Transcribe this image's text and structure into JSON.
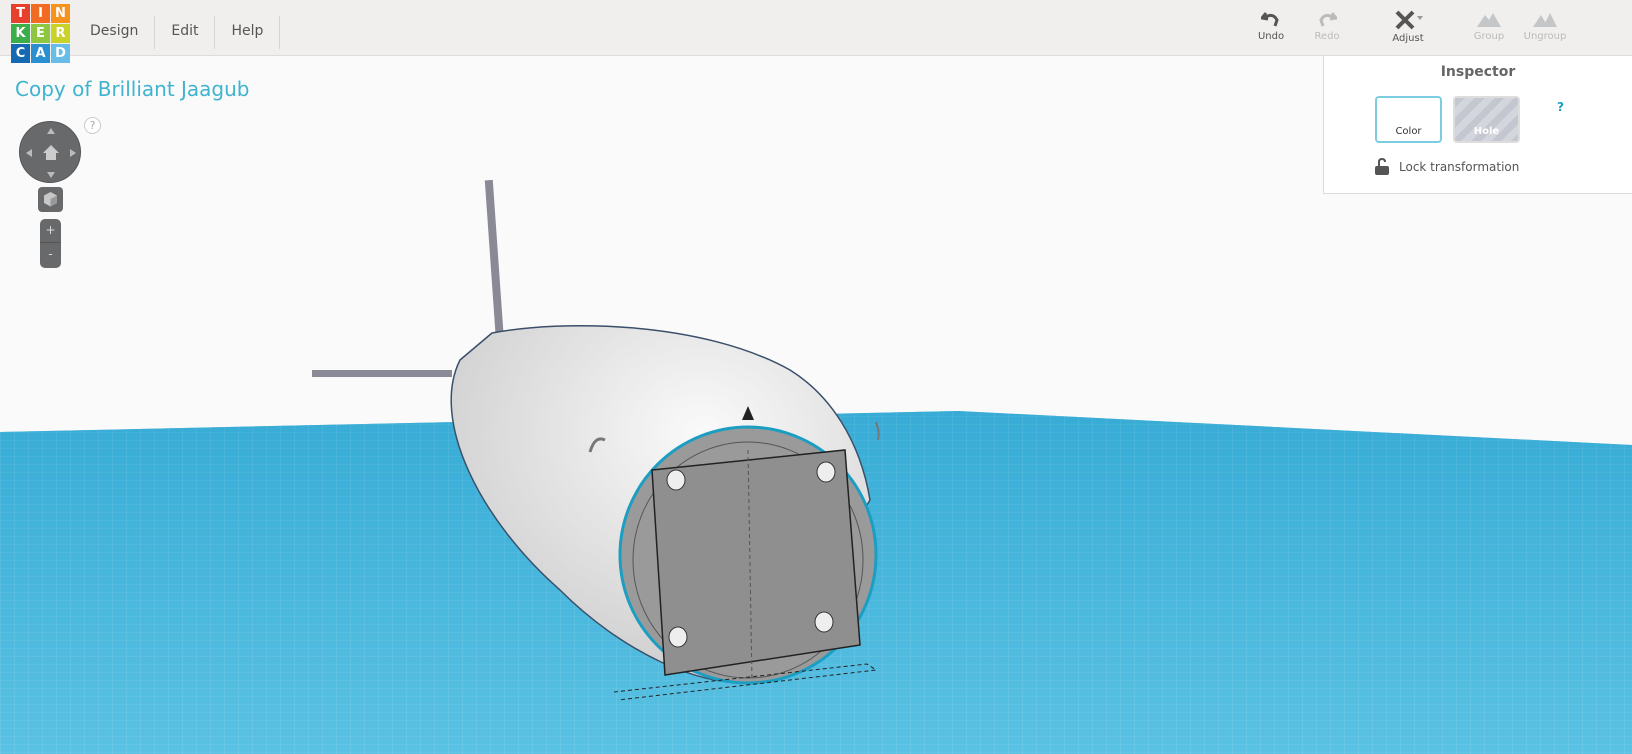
{
  "logo": {
    "letters": [
      "T",
      "I",
      "N",
      "K",
      "E",
      "R",
      "C",
      "A",
      "D"
    ],
    "colors": [
      "#e8412b",
      "#f26b22",
      "#f7931d",
      "#3cae49",
      "#8dc63f",
      "#c8d229",
      "#1569b3",
      "#2a8fd0",
      "#67bde8"
    ]
  },
  "menu": [
    "Design",
    "Edit",
    "Help"
  ],
  "toolbar": {
    "undo": "Undo",
    "redo": "Redo",
    "adjust": "Adjust",
    "group": "Group",
    "ungroup": "Ungroup"
  },
  "title": "Copy of Brilliant Jaagub",
  "view": {
    "help": "?",
    "zoom_in": "+",
    "zoom_out": "-"
  },
  "inspector": {
    "title": "Inspector",
    "color": "Color",
    "hole": "Hole",
    "help": "?",
    "lock": "Lock transformation"
  }
}
